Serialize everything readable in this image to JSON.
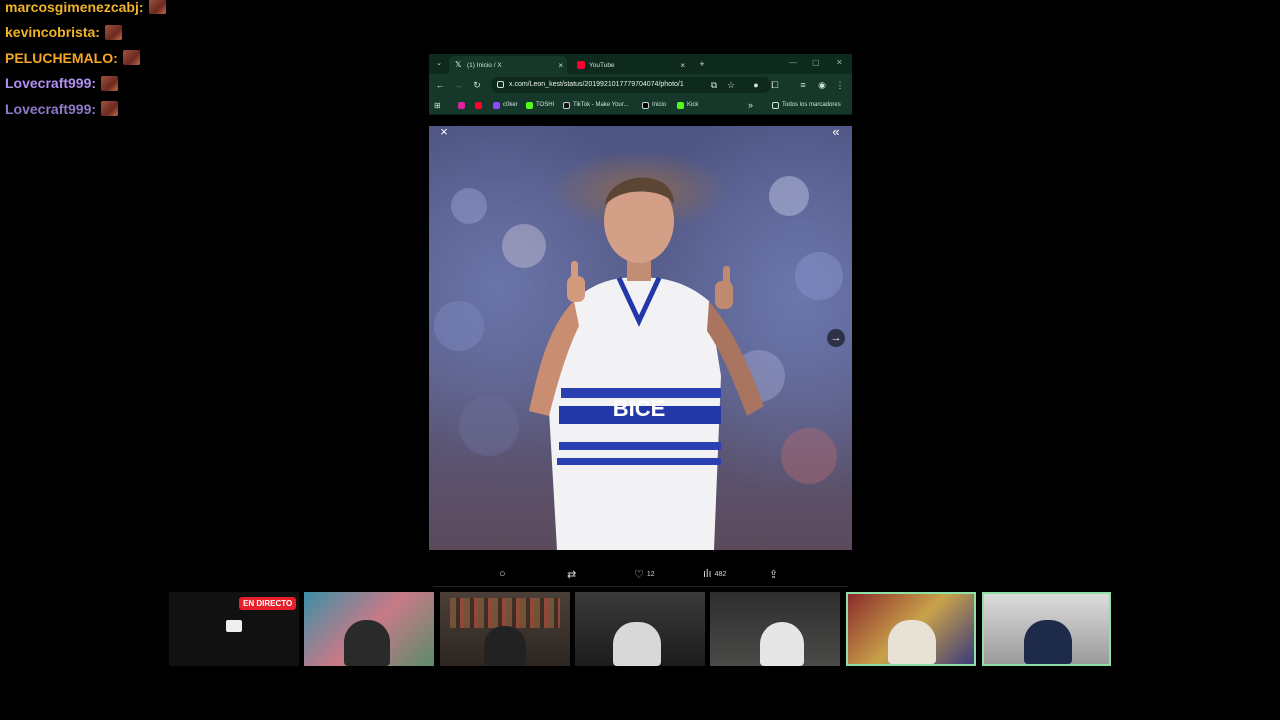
{
  "chat": {
    "messages": [
      {
        "user": "marcosgimenezcabj:",
        "color": "#f0b429"
      },
      {
        "user": "kevincobrista:",
        "color": "#f0b429"
      },
      {
        "user": "PELUCHEMALO:",
        "color": "#f5a623"
      },
      {
        "user": "Lovecraft999:",
        "color": "#b38ef3"
      },
      {
        "user": "Lovecraft999:",
        "color": "#8f78c9"
      }
    ]
  },
  "browser": {
    "tabs": [
      {
        "label": "(1) Inicio / X",
        "active": true
      },
      {
        "label": "YouTube",
        "active": false
      }
    ],
    "new_tab": "+",
    "url": "x.com/Leon_kest/status/2019921017779704074/photo/1",
    "bookmarks": [
      "c0ker",
      "TOSHI",
      "TikTok - Make Your...",
      "Inicio",
      "Kick"
    ],
    "bookmarks_overflow": "»",
    "all_bookmarks": "Todos los marcadores"
  },
  "viewer": {
    "close": "×",
    "collapse": "«",
    "next": "→",
    "shirt_text": "BICE"
  },
  "actions": {
    "likes": "12",
    "views": "482"
  },
  "streams": {
    "live_badge": "EN DIRECTO"
  },
  "colors": {
    "chrome_dark": "#0d2a1c",
    "chrome": "#15382a",
    "live": "#e91e2b",
    "selected_border": "#8ee0a6"
  }
}
